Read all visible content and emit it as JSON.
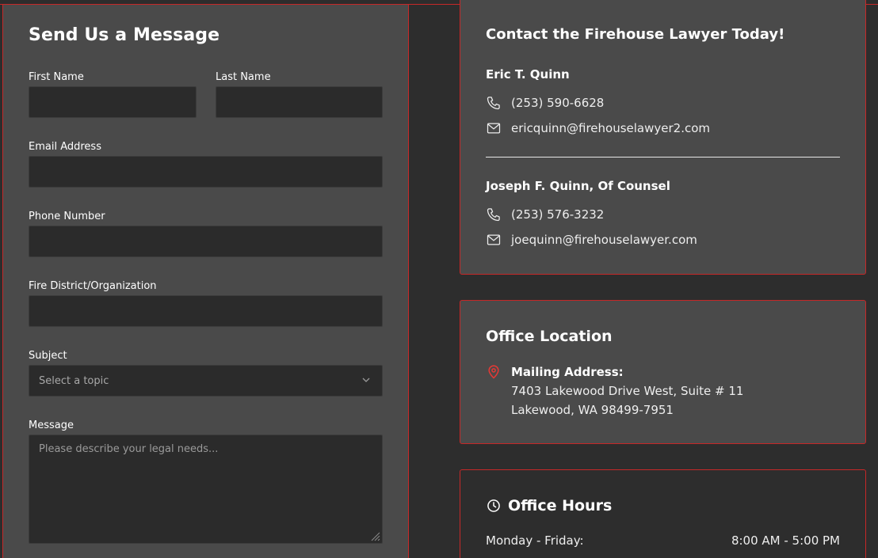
{
  "form": {
    "title": "Send Us a Message",
    "fields": {
      "first_name": {
        "label": "First Name",
        "value": ""
      },
      "last_name": {
        "label": "Last Name",
        "value": ""
      },
      "email": {
        "label": "Email Address",
        "value": ""
      },
      "phone": {
        "label": "Phone Number",
        "value": ""
      },
      "organization": {
        "label": "Fire District/Organization",
        "value": ""
      },
      "subject": {
        "label": "Subject",
        "selected": "Select a topic"
      },
      "message": {
        "label": "Message",
        "placeholder": "Please describe your legal needs..."
      }
    }
  },
  "contact": {
    "title": "Contact the Firehouse Lawyer Today!",
    "people": [
      {
        "name": "Eric T. Quinn",
        "phone": "(253) 590-6628",
        "email": "ericquinn@firehouselawyer2.com"
      },
      {
        "name": "Joseph F. Quinn, Of Counsel",
        "phone": "(253) 576-3232",
        "email": "joequinn@firehouselawyer.com"
      }
    ]
  },
  "location": {
    "title": "Office Location",
    "label": "Mailing Address:",
    "line1": "7403 Lakewood Drive West, Suite # 11",
    "line2": "Lakewood, WA 98499-7951"
  },
  "hours": {
    "title": "Office Hours",
    "rows": [
      {
        "day": "Monday - Friday:",
        "time": "8:00 AM - 5:00 PM"
      }
    ]
  },
  "colors": {
    "accent": "#c62828",
    "panel": "#4a4a4a",
    "field": "#2b2b2b",
    "background": "#2d2d2d"
  },
  "icons": [
    "phone-icon",
    "mail-icon",
    "map-pin-icon",
    "clock-icon",
    "chevron-down-icon"
  ]
}
